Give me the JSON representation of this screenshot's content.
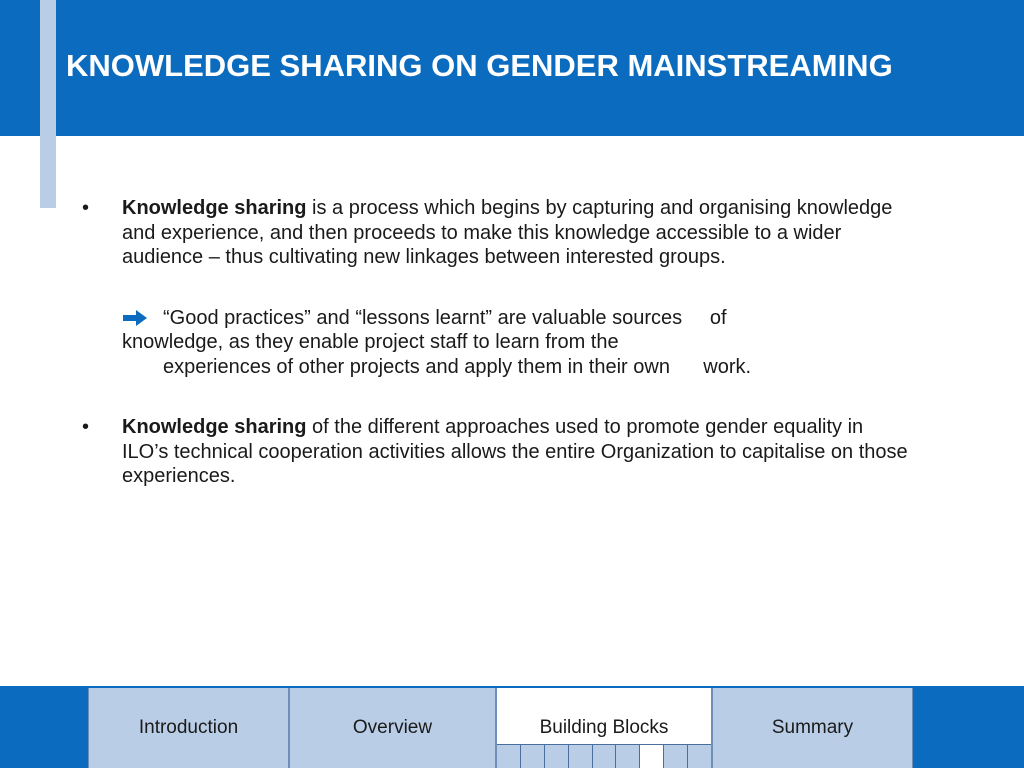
{
  "slide": {
    "title": "KNOWLEDGE SHARING ON GENDER MAINSTREAMING",
    "bullets": [
      {
        "bold": "Knowledge sharing",
        "text": " is a process which begins by capturing and organising knowledge and experience, and then proceeds to make this knowledge accessible to a wider audience – thus cultivating new linkages between interested groups."
      },
      {
        "bold": "Knowledge sharing",
        "text": " of the different approaches used to promote gender equality in ILO’s technical cooperation activities allows the entire Organization to capitalise on those experiences."
      }
    ],
    "note": {
      "icon": "right-arrow-icon",
      "line1": "“Good practices” and “lessons learnt” are valuable sources     of",
      "line2": "knowledge, as they enable project staff to learn from the",
      "line3": "experiences of other projects and apply them in their own      work."
    }
  },
  "nav": {
    "tabs": [
      {
        "label": "Introduction",
        "active": false
      },
      {
        "label": "Overview",
        "active": false
      },
      {
        "label": "Building Blocks",
        "active": true
      },
      {
        "label": "Summary",
        "active": false
      }
    ],
    "building_blocks_pages": 9,
    "current_page": 7
  },
  "colors": {
    "header": "#0b6bbf",
    "accent": "#b9cde6",
    "tab_active": "#ffffff"
  }
}
